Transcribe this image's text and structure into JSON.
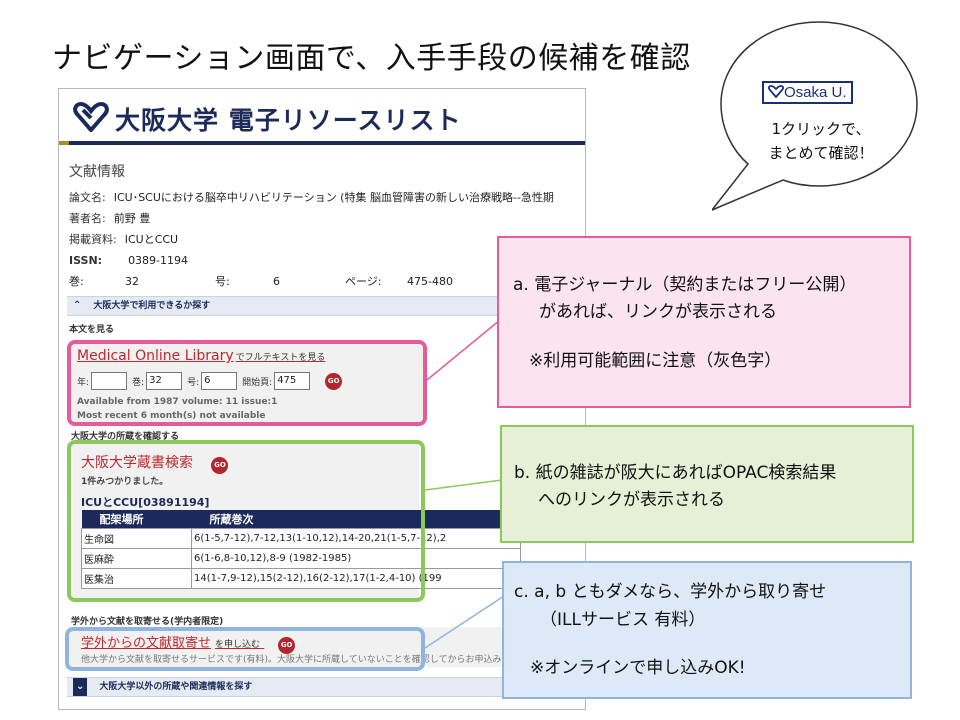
{
  "slide": {
    "title": "ナビゲーション画面で、入手手段の候補を確認"
  },
  "bubble": {
    "logo_text": "Osaka U.",
    "line1": "1クリックで、",
    "line2": "まとめて確認！"
  },
  "screenshot": {
    "brand": "大阪大学 電子リソースリスト",
    "section_title": "文献情報",
    "article_label": "論文名:",
    "article_title": "ICU･SCUにおける脳卒中リハビリテーション (特集 脳血管障害の新しい治療戦略--急性期",
    "author_label": "著者名:",
    "author": "前野 豊",
    "source_label": "掲載資料:",
    "source": "ICUとCCU",
    "issn_label": "ISSN:",
    "issn": "0389-1194",
    "volume_label": "巻:",
    "volume": "32",
    "issue_label": "号:",
    "issue": "6",
    "pages_label": "ページ:",
    "pages": "475-480",
    "bar1": "大阪大学で利用できるか探す",
    "fulltext_label": "本文を見る",
    "mol": {
      "link": "Medical Online Library",
      "link_sub": "でフルテキストを見る",
      "year_label": "年:",
      "year_value": "",
      "vol_label": "巻:",
      "vol_value": "32",
      "issue_label": "号:",
      "issue_value": "6",
      "start_label": "開始頁:",
      "start_value": "475",
      "go": "GO",
      "note1": "Available from 1987 volume: 11 issue:1",
      "note2": "Most recent 6 month(s) not available"
    },
    "holdings_label": "大阪大学の所蔵を確認する",
    "opac": {
      "link": "大阪大学蔵書検索",
      "go": "GO",
      "found": "1件みつかりました。",
      "journal": "ICUとCCU[03891194]",
      "col1": "配架場所",
      "col2": "所蔵巻次",
      "rows": [
        {
          "loc": "生命図",
          "holdings": "6(1-5,7-12),7-12,13(1-10,12),14-20,21(1-5,7-12),2"
        },
        {
          "loc": "医麻酔",
          "holdings": "6(1-6,8-10,12),8-9 (1982-1985)"
        },
        {
          "loc": "医集治",
          "holdings": "14(1-7,9-12),15(2-12),16(2-12),17(1-2,4-10) (199"
        }
      ]
    },
    "ill_label": "学外から文献を取寄せる(学内者限定)",
    "ill": {
      "link": "学外からの文献取寄せ",
      "link_sub": "を申し込む",
      "go": "GO",
      "desc": "他大学から文献を取寄せるサービスです(有料)。大阪大学に所蔵していないことを確認してからお申込みくださ"
    },
    "bar2": "大阪大学以外の所蔵や関連情報を探す"
  },
  "callouts": {
    "a_line1": "a. 電子ジャーナル（契約またはフリー公開）",
    "a_line2": "があれば、リンクが表示される",
    "a_line3": "※利用可能範囲に注意（灰色字）",
    "b_line1": "b. 紙の雑誌が阪大にあればOPAC検索結果",
    "b_line2": "へのリンクが表示される",
    "c_line1": "c.   a, b ともダメなら、学外から取り寄せ",
    "c_line2": "（ILLサービス   有料）",
    "c_line3": "※オンラインで申し込みOK!"
  },
  "colors": {
    "navy": "#1b2a5a",
    "link_red": "#c0282e",
    "pink": "#e65c9a",
    "green": "#8cc85a",
    "blue": "#8fb5de"
  },
  "icons": {
    "logo": "osaka-university-emblem-icon",
    "go": "go-button-icon",
    "chevron_up": "double-chevron-up-icon",
    "chevron_down": "double-chevron-down-icon"
  }
}
